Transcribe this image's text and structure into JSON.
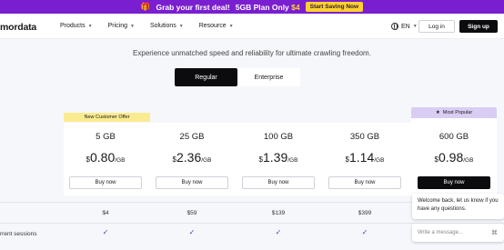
{
  "promo": {
    "text": "Grab your first deal!",
    "plan_text": "5GB Plan Only",
    "plan_price": "$4",
    "cta": "Start Saving Now",
    "icon": "gift-icon"
  },
  "nav": {
    "logo": "mordata",
    "menu": [
      "Products",
      "Pricing",
      "Solutions",
      "Resource"
    ],
    "language": "EN",
    "login": "Log in",
    "signup": "Sign up"
  },
  "subtitle": "Experience unmatched speed and reliability for ultimate crawling freedom.",
  "toggle": {
    "regular": "Regular",
    "enterprise": "Enterprise",
    "active": "Regular"
  },
  "badges": {
    "new_customer": "New Customer Offer",
    "most_popular": "Most Popular"
  },
  "plans": [
    {
      "size": "5 GB",
      "currency": "$",
      "amount": "0.80",
      "unit": "/GB",
      "button": "Buy now",
      "total": "$4"
    },
    {
      "size": "25 GB",
      "currency": "$",
      "amount": "2.36",
      "unit": "/GB",
      "button": "Buy now",
      "total": "$59"
    },
    {
      "size": "100 GB",
      "currency": "$",
      "amount": "1.39",
      "unit": "/GB",
      "button": "Buy now",
      "total": "$139"
    },
    {
      "size": "350 GB",
      "currency": "$",
      "amount": "1.14",
      "unit": "/GB",
      "button": "Buy now",
      "total": "$399"
    },
    {
      "size": "600 GB",
      "currency": "$",
      "amount": "0.98",
      "unit": "/GB",
      "button": "Buy now",
      "total": ""
    }
  ],
  "features": {
    "sessions_label": "rrent sessions"
  },
  "chat": {
    "message": "Welcome back, let us know if you have any questions.",
    "placeholder": "Write a message..."
  },
  "colors": {
    "promo_bg": "#7a1fcf",
    "accent": "#ffd22e",
    "primary": "#0c0c0f",
    "popular_badge": "#d9cdf3",
    "new_badge": "#fbeb90",
    "check": "#3d45b8"
  }
}
